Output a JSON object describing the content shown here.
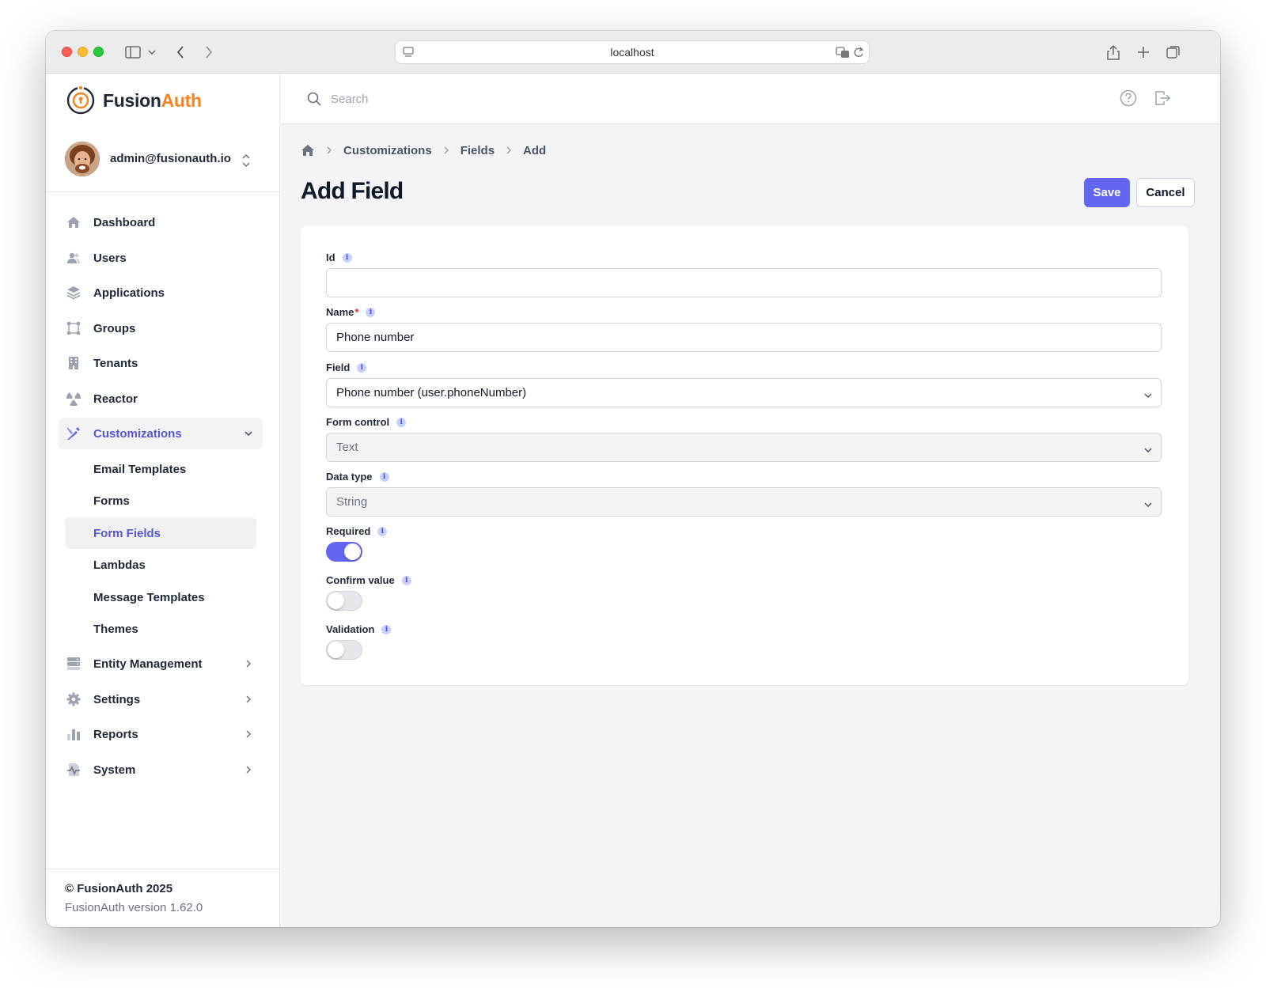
{
  "browser": {
    "url": "localhost"
  },
  "brand": {
    "name_part1": "Fusion",
    "name_part2": "Auth"
  },
  "user": {
    "email": "admin@fusionauth.io"
  },
  "sidebar": {
    "items": [
      {
        "label": "Dashboard",
        "icon": "home-icon"
      },
      {
        "label": "Users",
        "icon": "users-icon"
      },
      {
        "label": "Applications",
        "icon": "layers-icon"
      },
      {
        "label": "Groups",
        "icon": "groups-icon"
      },
      {
        "label": "Tenants",
        "icon": "building-icon"
      },
      {
        "label": "Reactor",
        "icon": "reactor-icon"
      },
      {
        "label": "Customizations",
        "icon": "customizations-icon"
      }
    ],
    "sub_items": [
      {
        "label": "Email Templates"
      },
      {
        "label": "Forms"
      },
      {
        "label": "Form Fields"
      },
      {
        "label": "Lambdas"
      },
      {
        "label": "Message Templates"
      },
      {
        "label": "Themes"
      }
    ],
    "items_after": [
      {
        "label": "Entity Management",
        "icon": "entity-icon"
      },
      {
        "label": "Settings",
        "icon": "gear-icon"
      },
      {
        "label": "Reports",
        "icon": "reports-icon"
      },
      {
        "label": "System",
        "icon": "system-icon"
      }
    ],
    "footer": {
      "copyright": "© FusionAuth 2025",
      "version": "FusionAuth version 1.62.0"
    }
  },
  "header": {
    "search_placeholder": "Search"
  },
  "breadcrumb": [
    "Customizations",
    "Fields",
    "Add"
  ],
  "page": {
    "title": "Add Field",
    "save_label": "Save",
    "cancel_label": "Cancel"
  },
  "form": {
    "id": {
      "label": "Id",
      "value": ""
    },
    "name": {
      "label": "Name",
      "required_mark": "*",
      "value": "Phone number"
    },
    "field": {
      "label": "Field",
      "value": "Phone number (user.phoneNumber)"
    },
    "form_control": {
      "label": "Form control",
      "value": "Text"
    },
    "data_type": {
      "label": "Data type",
      "value": "String"
    },
    "required": {
      "label": "Required",
      "on": true
    },
    "confirm_value": {
      "label": "Confirm value",
      "on": false
    },
    "validation": {
      "label": "Validation",
      "on": false
    }
  },
  "colors": {
    "accent": "#6366f1",
    "brand_orange": "#f58320"
  }
}
